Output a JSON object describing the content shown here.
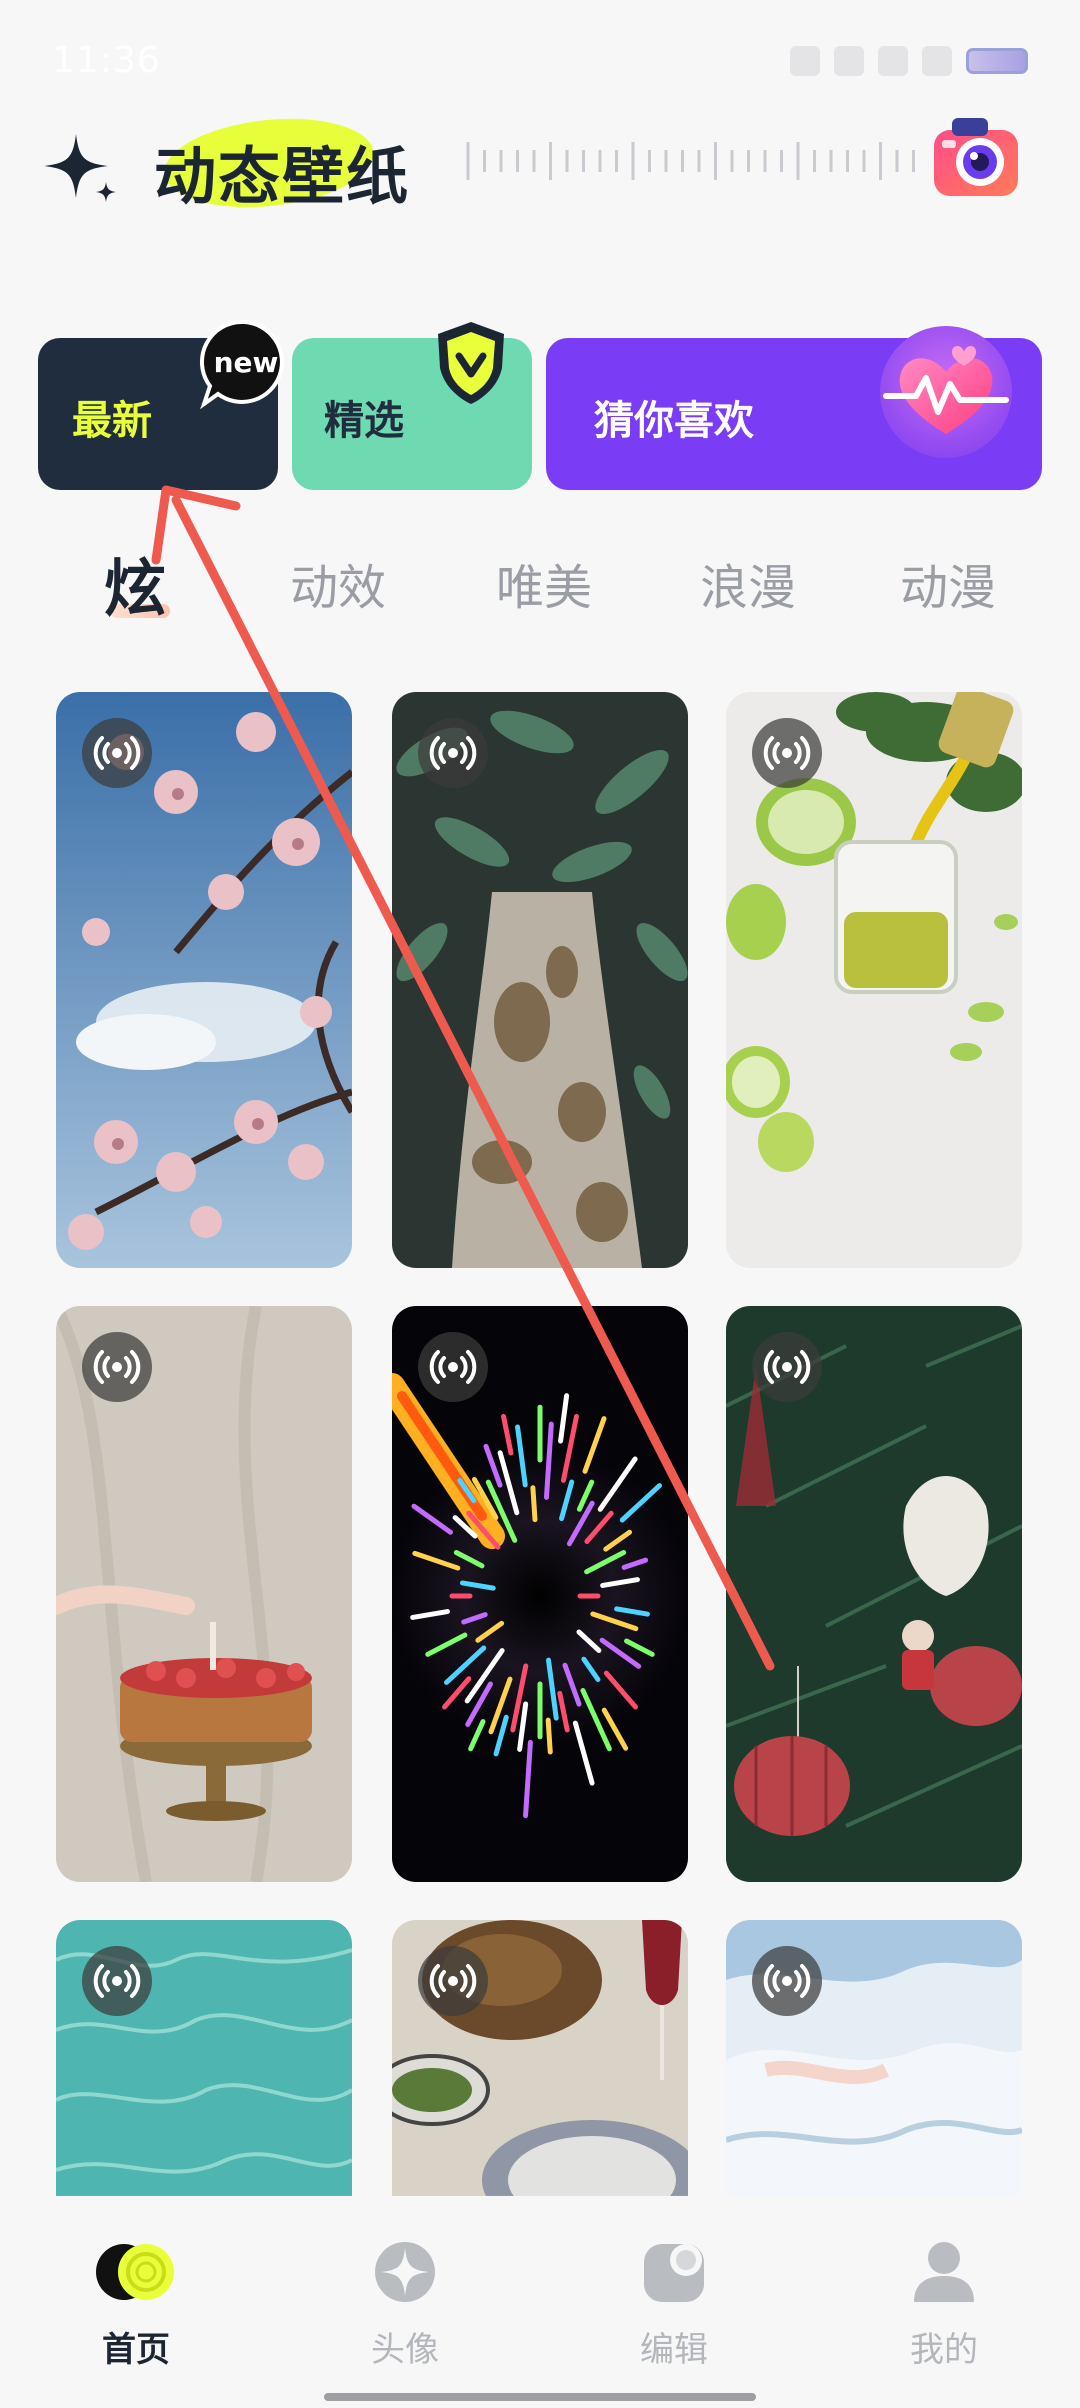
{
  "status_bar": {
    "time": "11:36"
  },
  "header": {
    "title": "动态壁纸",
    "camera_icon": "camera-icon",
    "sparkle_icon": "sparkle-icon"
  },
  "categories": [
    {
      "label": "最新",
      "badge": "new",
      "color": "#1f2d3e"
    },
    {
      "label": "精选",
      "badge": "v",
      "color": "#6fd9b2"
    },
    {
      "label": "猜你喜欢",
      "badge": "heart",
      "color": "#7a3cf5"
    }
  ],
  "tabs": [
    {
      "label": "炫",
      "active": true
    },
    {
      "label": "动效",
      "active": false
    },
    {
      "label": "唯美",
      "active": false
    },
    {
      "label": "浪漫",
      "active": false
    },
    {
      "label": "动漫",
      "active": false
    }
  ],
  "wallpapers": [
    {
      "subject": "cherry-blossom"
    },
    {
      "subject": "eucalyptus-tree"
    },
    {
      "subject": "lime-juice"
    },
    {
      "subject": "cake-candle"
    },
    {
      "subject": "space-warp"
    },
    {
      "subject": "christmas-ornaments"
    },
    {
      "subject": "pool-water"
    },
    {
      "subject": "dinner-table"
    },
    {
      "subject": "snow-landscape"
    }
  ],
  "bottom_nav": [
    {
      "label": "首页",
      "icon": "home-icon",
      "active": true
    },
    {
      "label": "头像",
      "icon": "avatar-star-icon",
      "active": false
    },
    {
      "label": "编辑",
      "icon": "edit-icon",
      "active": false
    },
    {
      "label": "我的",
      "icon": "profile-icon",
      "active": false
    }
  ],
  "colors": {
    "accent": "#e8ff3a",
    "annotation": "#ef5a4f"
  }
}
